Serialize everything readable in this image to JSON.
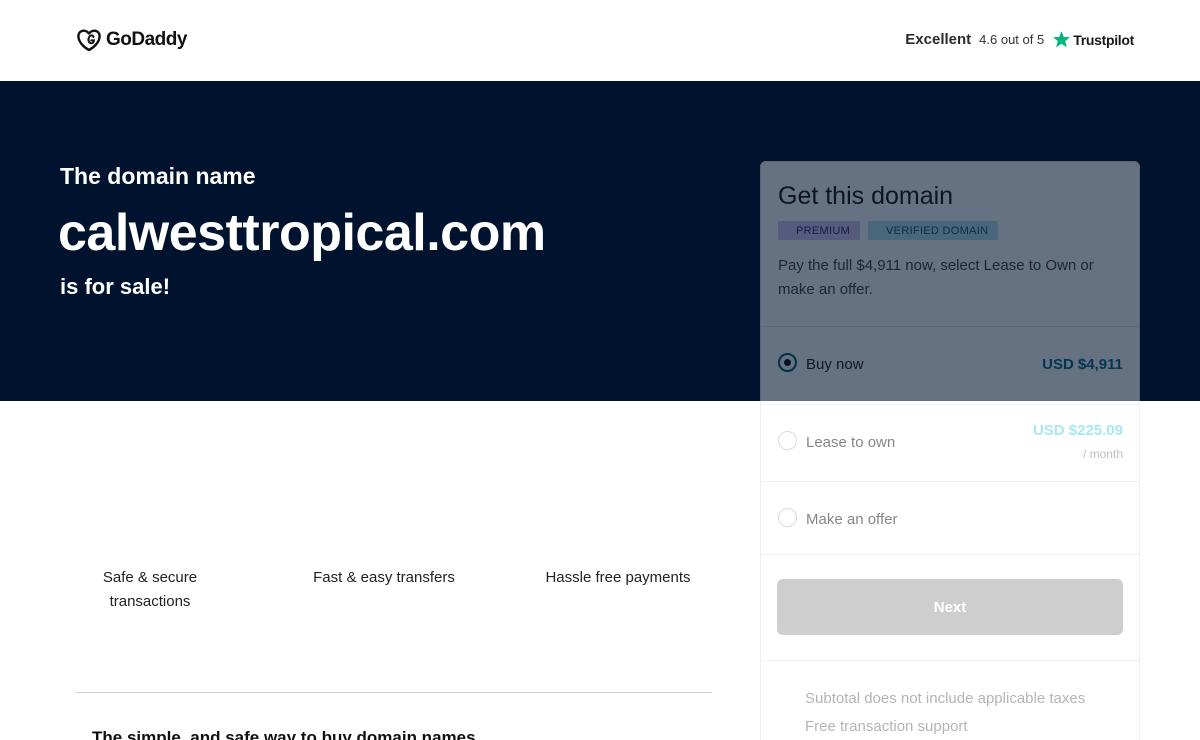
{
  "header": {
    "logo_text": "GoDaddy",
    "trust_label": "Excellent",
    "trust_rating": "4.6 out of 5",
    "trust_brand": "Trustpilot",
    "trust_star_color": "#00b67a"
  },
  "hero": {
    "pre_text": "The domain name",
    "domain": "calwesttropical.com",
    "post_text": "is for sale!",
    "background": "#00132e"
  },
  "features": [
    {
      "line1": "Safe & secure",
      "line2": "transactions"
    },
    {
      "line1": "Fast & easy transfers",
      "line2": ""
    },
    {
      "line1": "Hassle free payments",
      "line2": ""
    }
  ],
  "bottom_heading": "The simple, and safe way to buy domain names",
  "card": {
    "title": "Get this domain",
    "badge_premium": "PREMIUM",
    "badge_verified": "VERIFIED DOMAIN",
    "description": "Pay the full $4,911 now, select Lease to Own or make an offer.",
    "options": [
      {
        "label": "Buy now",
        "price": "USD $4,911",
        "sub": "",
        "checked": true
      },
      {
        "label": "Lease to own",
        "price": "USD $225.09",
        "sub": "/ month",
        "checked": false
      },
      {
        "label": "Make an offer",
        "price": "",
        "sub": "",
        "checked": false
      }
    ],
    "next_label": "Next",
    "footer_lines": [
      "Subtotal does not include applicable taxes",
      "Free transaction support"
    ]
  }
}
